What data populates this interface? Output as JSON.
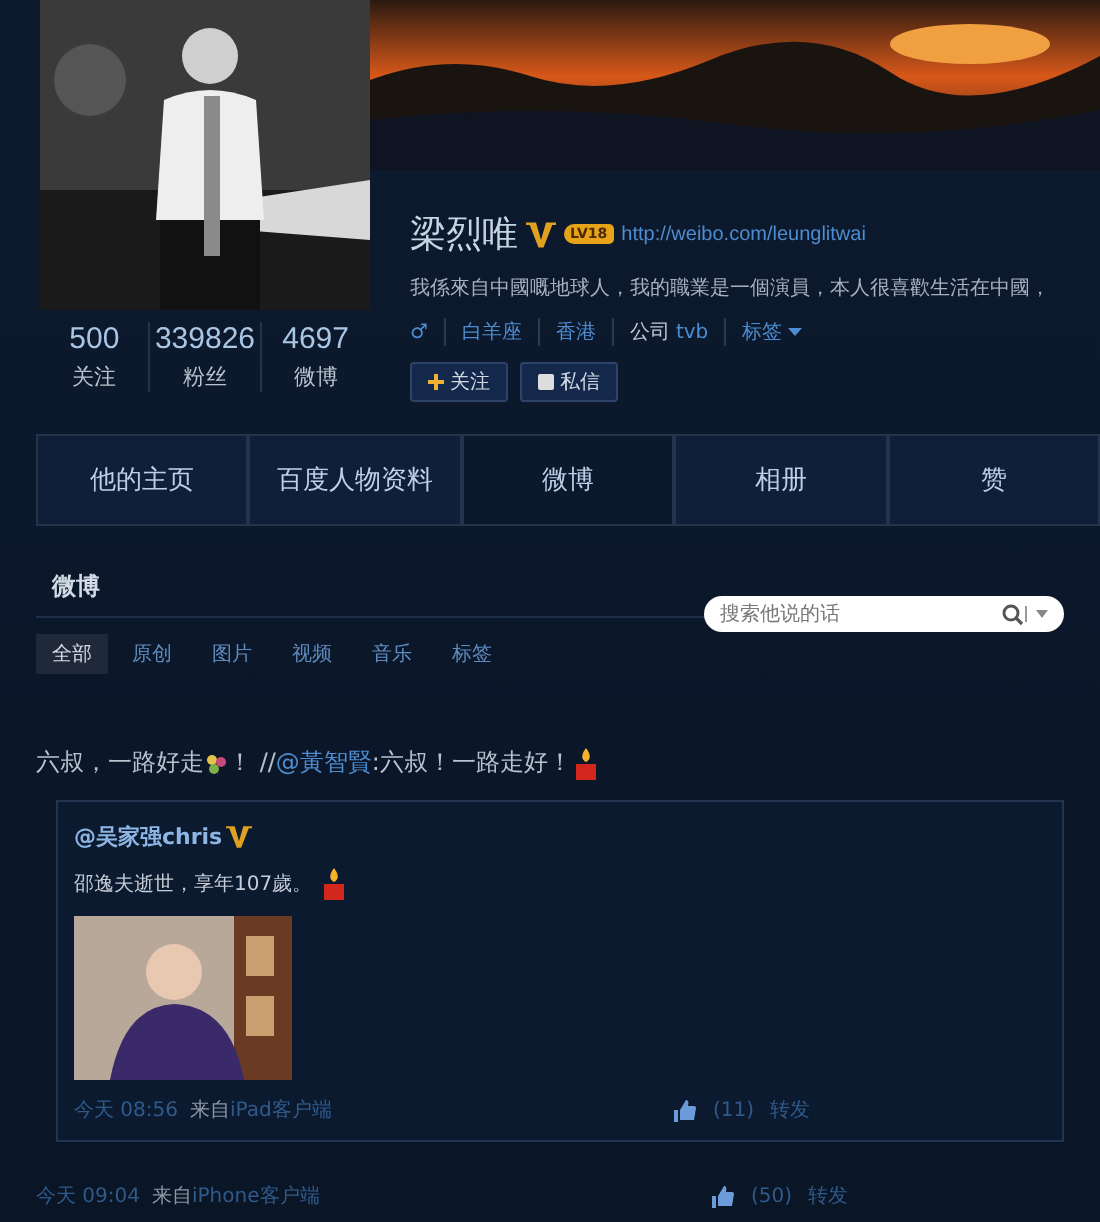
{
  "profile": {
    "avatar": {
      "kind": "picture"
    },
    "banner": {
      "kind": "picture"
    },
    "name": "梁烈唯",
    "verified": true,
    "level_badge": "LV18",
    "url": "http://weibo.com/leunglitwai",
    "bio": "我係來自中國嘅地球人，我的職業是一個演員，本人很喜歡生活在中國，",
    "details": [
      {
        "kind": "gender",
        "text": "♂"
      },
      {
        "kind": "link",
        "text": "白羊座"
      },
      {
        "kind": "link",
        "text": "香港"
      },
      {
        "kind": "company",
        "label": "公司",
        "text": "tvb"
      },
      {
        "kind": "dropdown",
        "text": "标签"
      }
    ],
    "stats": [
      {
        "value": "500",
        "label": "关注"
      },
      {
        "value": "339826",
        "label": "粉丝"
      },
      {
        "value": "4697",
        "label": "微博"
      }
    ],
    "buttons": [
      {
        "kind": "follow",
        "label": "关注"
      },
      {
        "kind": "message",
        "label": "私信"
      }
    ]
  },
  "tabs": [
    {
      "label": "他的主页",
      "selected": false
    },
    {
      "label": "百度人物资料",
      "selected": false
    },
    {
      "label": "微博",
      "selected": true
    },
    {
      "label": "相册",
      "selected": false
    },
    {
      "label": "赞",
      "selected": false
    }
  ],
  "feed": {
    "title": "微博",
    "search": {
      "placeholder": "搜索他说的话"
    },
    "filters": [
      {
        "label": "全部",
        "selected": true
      },
      {
        "label": "原创",
        "selected": false
      },
      {
        "label": "图片",
        "selected": false
      },
      {
        "label": "视频",
        "selected": false
      },
      {
        "label": "音乐",
        "selected": false
      },
      {
        "label": "标签",
        "selected": false
      }
    ],
    "post": {
      "text_before": "六叔，一路好走",
      "text_mid": "！ //",
      "mention": "@黃智賢",
      "text_after": ":六叔！一路走好！",
      "quote": {
        "author": "@吴家强chris",
        "verified": true,
        "text": "邵逸夫逝世，享年107歲。",
        "image": {
          "kind": "picture"
        },
        "time": "今天 08:56",
        "source_prefix": "来自",
        "source": "iPad客户端",
        "likes": "(11)",
        "actions": [
          "转发"
        ]
      },
      "time": "今天 09:04",
      "source_prefix": "来自",
      "source": "iPhone客户端",
      "likes": "(50)",
      "actions": [
        "转发"
      ]
    }
  }
}
